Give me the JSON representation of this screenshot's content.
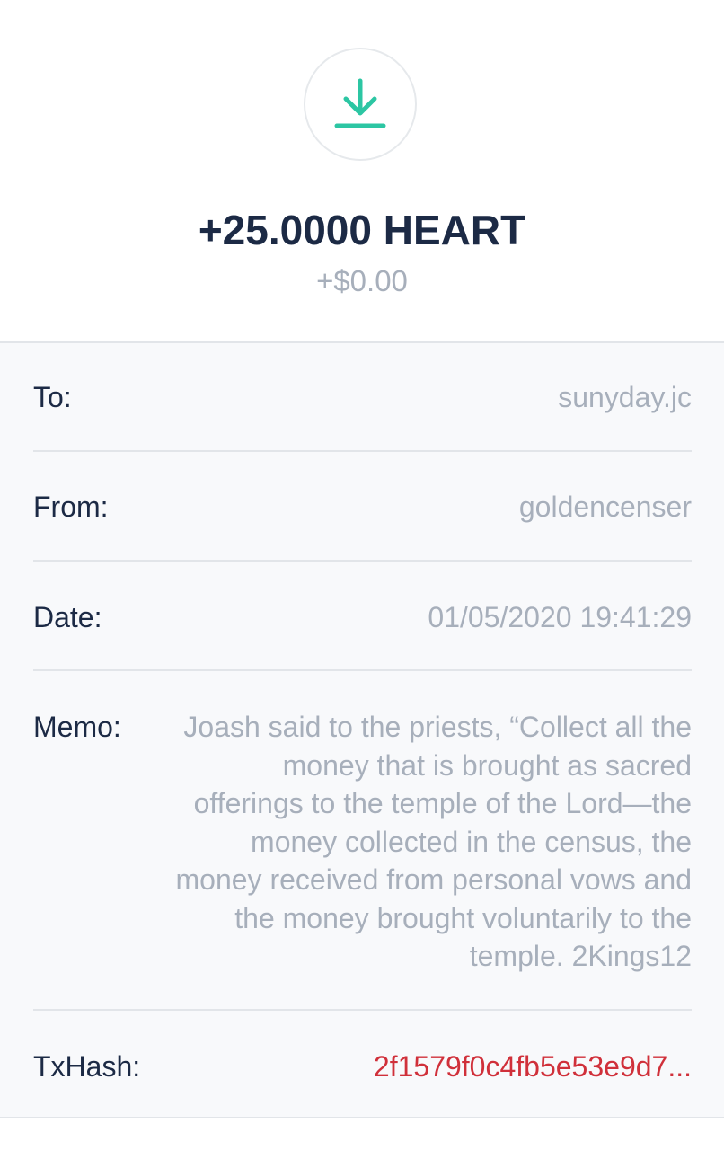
{
  "header": {
    "icon": "download-icon",
    "icon_color": "#2cc6a3",
    "amount": "+25.0000 HEART",
    "fiat": "+$0.00"
  },
  "details": {
    "to": {
      "label": "To:",
      "value": "sunyday.jc"
    },
    "from": {
      "label": "From:",
      "value": "goldencenser"
    },
    "date": {
      "label": "Date:",
      "value": "01/05/2020 19:41:29"
    },
    "memo": {
      "label": "Memo:",
      "value": "Joash said to the priests, “Collect all the money that is brought as sacred offerings to the temple of the Lord—the money collected in the census, the money received from personal vows and the money brought voluntarily to the temple. 2Kings12"
    },
    "txhash": {
      "label": "TxHash:",
      "value": "2f1579f0c4fb5e53e9d7...",
      "color": "#d0303a"
    }
  }
}
